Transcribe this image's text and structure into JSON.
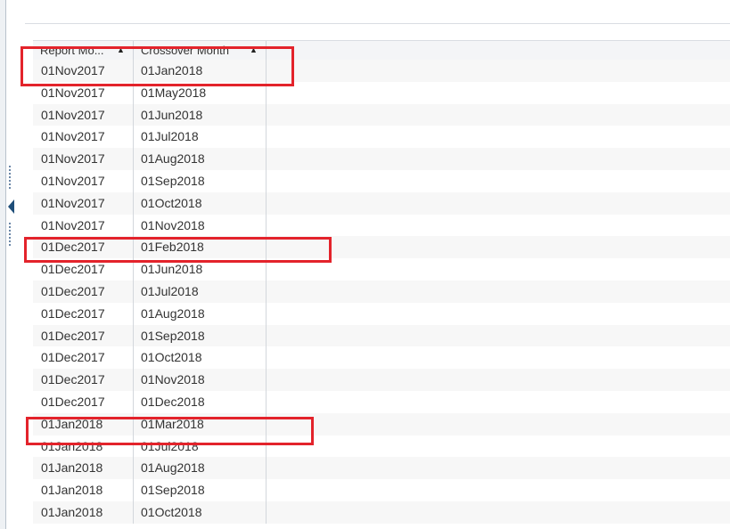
{
  "table": {
    "columns": [
      {
        "label": "Report Mo...",
        "sort": "ascending"
      },
      {
        "label": "Crossover Month",
        "sort": "ascending"
      }
    ],
    "rows": [
      {
        "report_month": "01Nov2017",
        "crossover_month": "01Jan2018"
      },
      {
        "report_month": "01Nov2017",
        "crossover_month": "01May2018"
      },
      {
        "report_month": "01Nov2017",
        "crossover_month": "01Jun2018"
      },
      {
        "report_month": "01Nov2017",
        "crossover_month": "01Jul2018"
      },
      {
        "report_month": "01Nov2017",
        "crossover_month": "01Aug2018"
      },
      {
        "report_month": "01Nov2017",
        "crossover_month": "01Sep2018"
      },
      {
        "report_month": "01Nov2017",
        "crossover_month": "01Oct2018"
      },
      {
        "report_month": "01Nov2017",
        "crossover_month": "01Nov2018"
      },
      {
        "report_month": "01Dec2017",
        "crossover_month": "01Feb2018"
      },
      {
        "report_month": "01Dec2017",
        "crossover_month": "01Jun2018"
      },
      {
        "report_month": "01Dec2017",
        "crossover_month": "01Jul2018"
      },
      {
        "report_month": "01Dec2017",
        "crossover_month": "01Aug2018"
      },
      {
        "report_month": "01Dec2017",
        "crossover_month": "01Sep2018"
      },
      {
        "report_month": "01Dec2017",
        "crossover_month": "01Oct2018"
      },
      {
        "report_month": "01Dec2017",
        "crossover_month": "01Nov2018"
      },
      {
        "report_month": "01Dec2017",
        "crossover_month": "01Dec2018"
      },
      {
        "report_month": "01Jan2018",
        "crossover_month": "01Mar2018"
      },
      {
        "report_month": "01Jan2018",
        "crossover_month": "01Jul2018"
      },
      {
        "report_month": "01Jan2018",
        "crossover_month": "01Aug2018"
      },
      {
        "report_month": "01Jan2018",
        "crossover_month": "01Sep2018"
      },
      {
        "report_month": "01Jan2018",
        "crossover_month": "01Oct2018"
      }
    ]
  },
  "icons": {
    "sort_ascending": "▲",
    "splitter_arrow": "collapse-left-arrow"
  },
  "colors": {
    "highlight": "#e3232b",
    "accent": "#1f4e79"
  }
}
